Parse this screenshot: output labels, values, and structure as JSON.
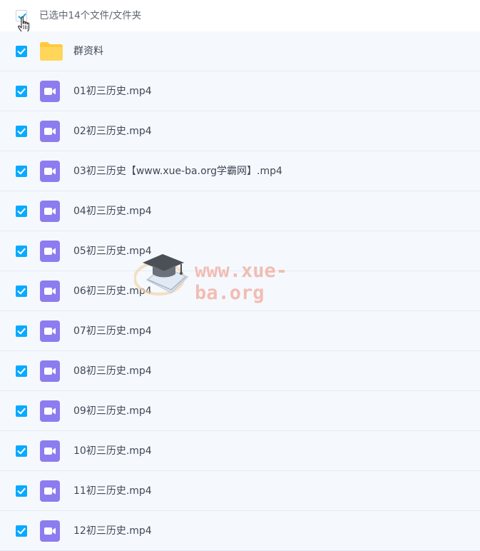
{
  "header": {
    "selection_text": "已选中14个文件/文件夹"
  },
  "files": [
    {
      "name": "群资料",
      "type": "folder"
    },
    {
      "name": "01初三历史.mp4",
      "type": "video"
    },
    {
      "name": "02初三历史.mp4",
      "type": "video"
    },
    {
      "name": "03初三历史【www.xue-ba.org学霸网】.mp4",
      "type": "video"
    },
    {
      "name": "04初三历史.mp4",
      "type": "video"
    },
    {
      "name": "05初三历史.mp4",
      "type": "video"
    },
    {
      "name": "06初三历史.mp4",
      "type": "video"
    },
    {
      "name": "07初三历史.mp4",
      "type": "video"
    },
    {
      "name": "08初三历史.mp4",
      "type": "video"
    },
    {
      "name": "09初三历史.mp4",
      "type": "video"
    },
    {
      "name": "10初三历史.mp4",
      "type": "video"
    },
    {
      "name": "11初三历史.mp4",
      "type": "video"
    },
    {
      "name": "12初三历史.mp4",
      "type": "video"
    }
  ],
  "watermark": {
    "text": "www.xue-ba.org"
  },
  "colors": {
    "checkbox": "#09aaff",
    "video_icon": "#8b7cf0",
    "folder_icon": "#ffd04f",
    "row_background": "#f5f9fe"
  },
  "icons": {
    "folder": "folder-icon",
    "video": "video-file-icon",
    "checkbox": "checkmark-icon",
    "cursor": "hand-pointer-icon"
  }
}
